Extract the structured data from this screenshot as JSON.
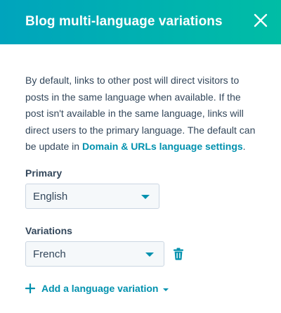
{
  "header": {
    "title": "Blog multi-language variations"
  },
  "description": {
    "text": "By default, links to other post will direct visitors to posts in the same language when available. If the post isn't available in the same language, links will direct users to the primary language. The default can be update in ",
    "link_label": "Domain & URLs language settings",
    "trailing": "."
  },
  "primary": {
    "label": "Primary",
    "selected": "English"
  },
  "variations": {
    "label": "Variations",
    "selected": "French"
  },
  "add_variation": {
    "label": "Add a language variation"
  },
  "colors": {
    "header_gradient_start": "#00a4bd",
    "header_gradient_end": "#00bda5",
    "link": "#0091ae",
    "text": "#33475b",
    "select_bg": "#f5f8fa",
    "select_border": "#cbd6e2"
  }
}
